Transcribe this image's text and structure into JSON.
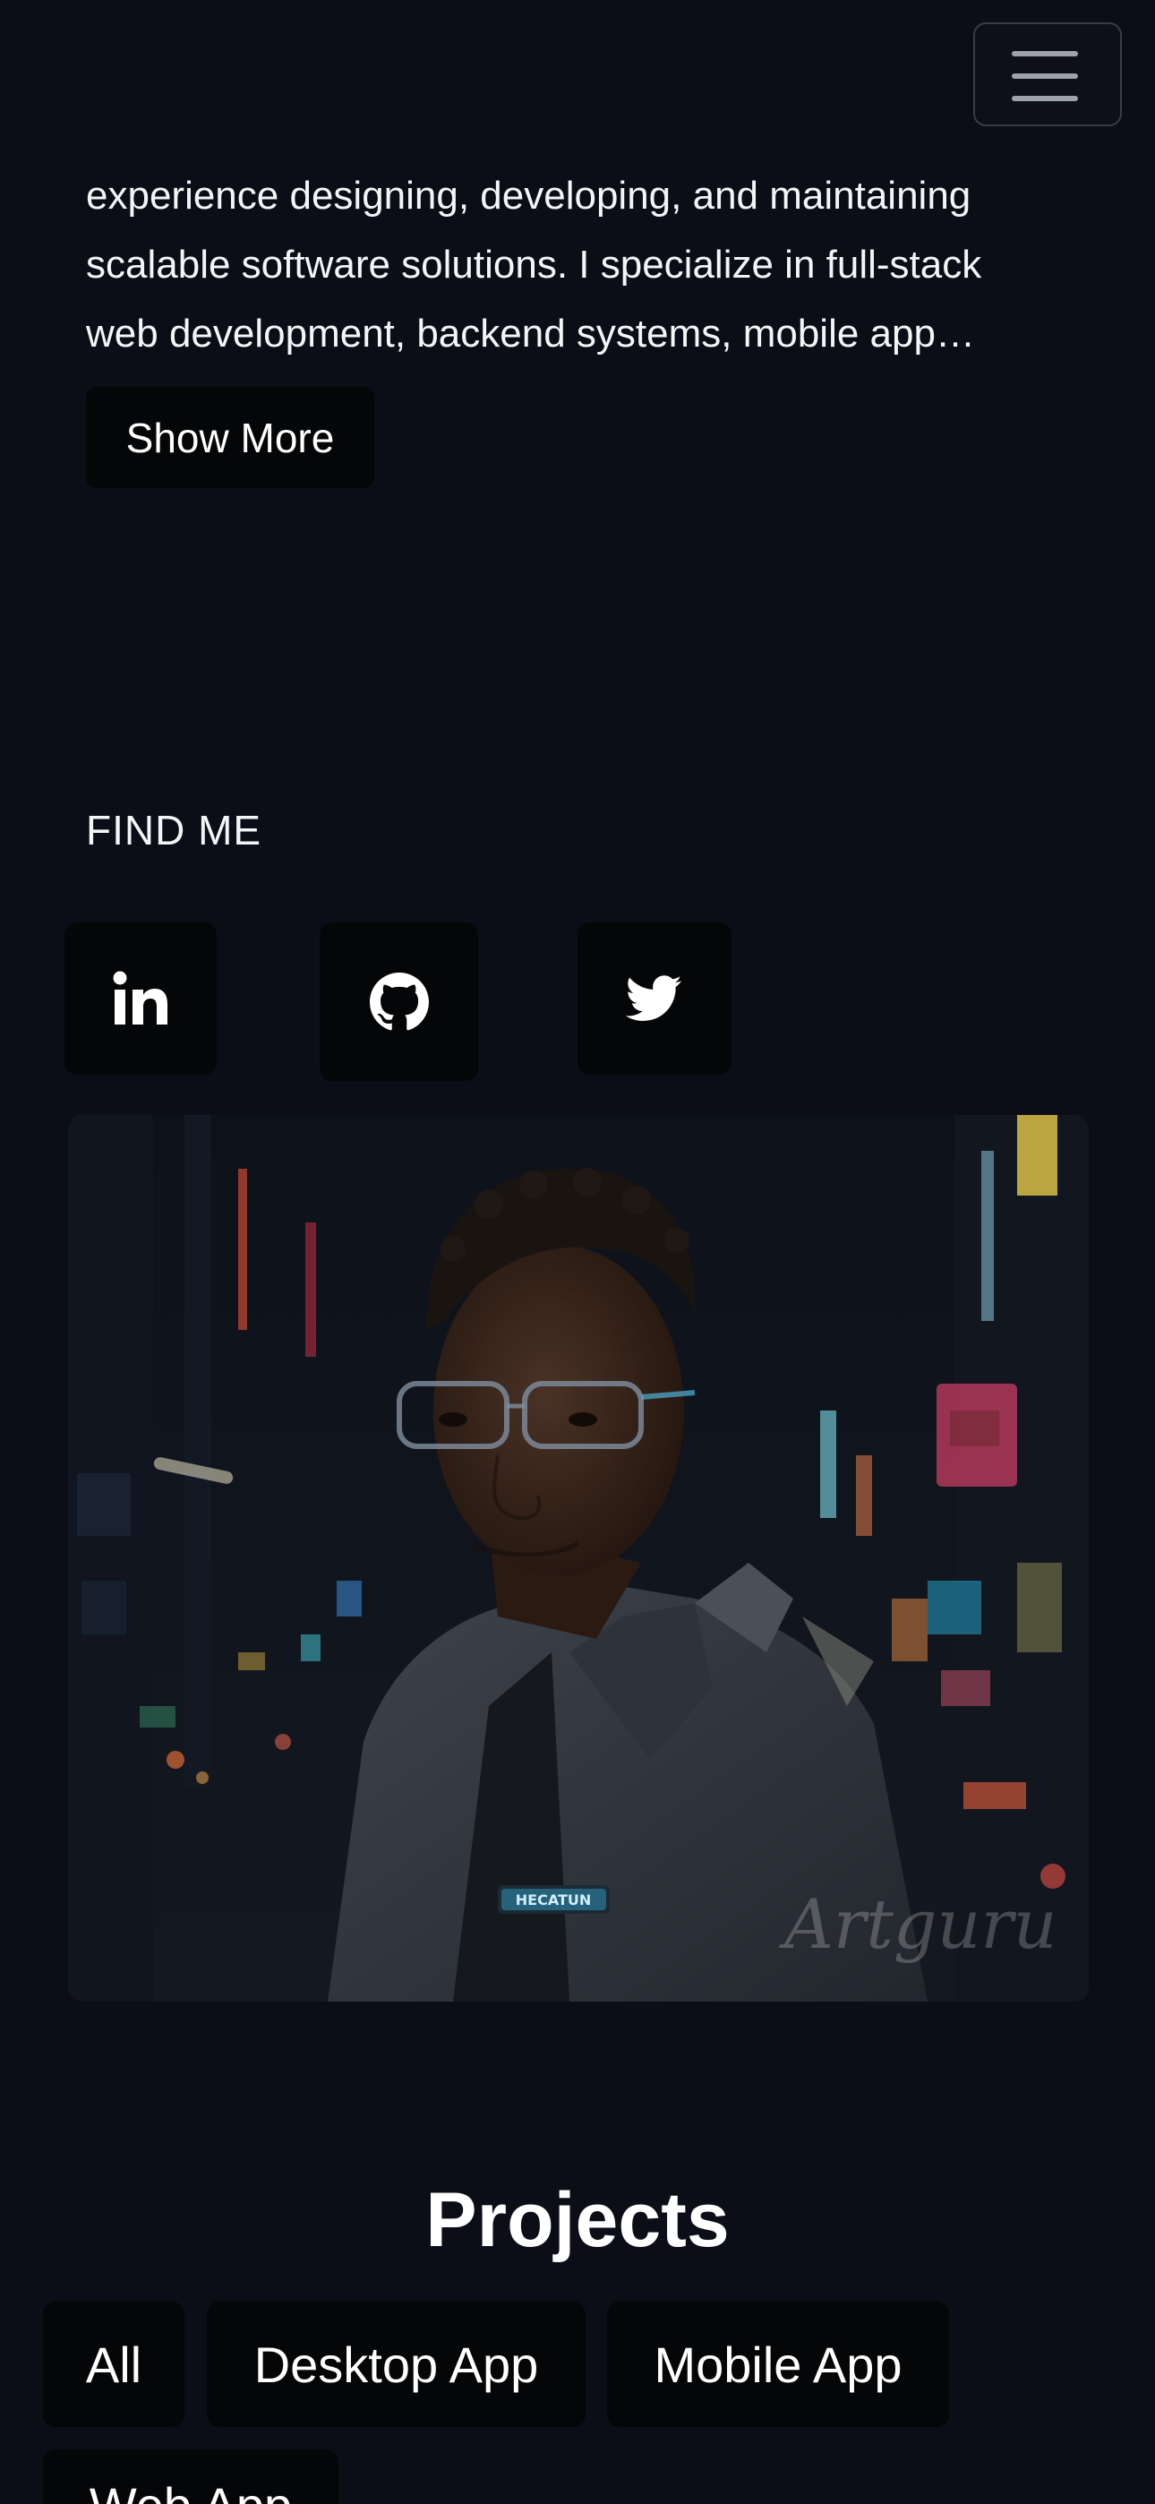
{
  "header": {
    "menu_icon": "hamburger-menu-icon"
  },
  "about": {
    "lines": [
      "experience designing, developing, and maintaining",
      "scalable software solutions. I specialize in full-stack",
      "web development, backend systems, mobile app…"
    ],
    "show_more_label": "Show More"
  },
  "find_me": {
    "heading": "FIND ME",
    "links": [
      {
        "icon": "linkedin-icon"
      },
      {
        "icon": "github-icon"
      },
      {
        "icon": "twitter-icon"
      }
    ]
  },
  "portrait": {
    "watermark": "Artguru",
    "jacket_badge": "HECATUN"
  },
  "projects": {
    "title": "Projects",
    "filters": [
      "All",
      "Desktop App",
      "Mobile App",
      "Web App"
    ]
  },
  "colors": {
    "background": "#0b0e17",
    "button_bg": "#050608",
    "text": "#f4f5f7"
  }
}
